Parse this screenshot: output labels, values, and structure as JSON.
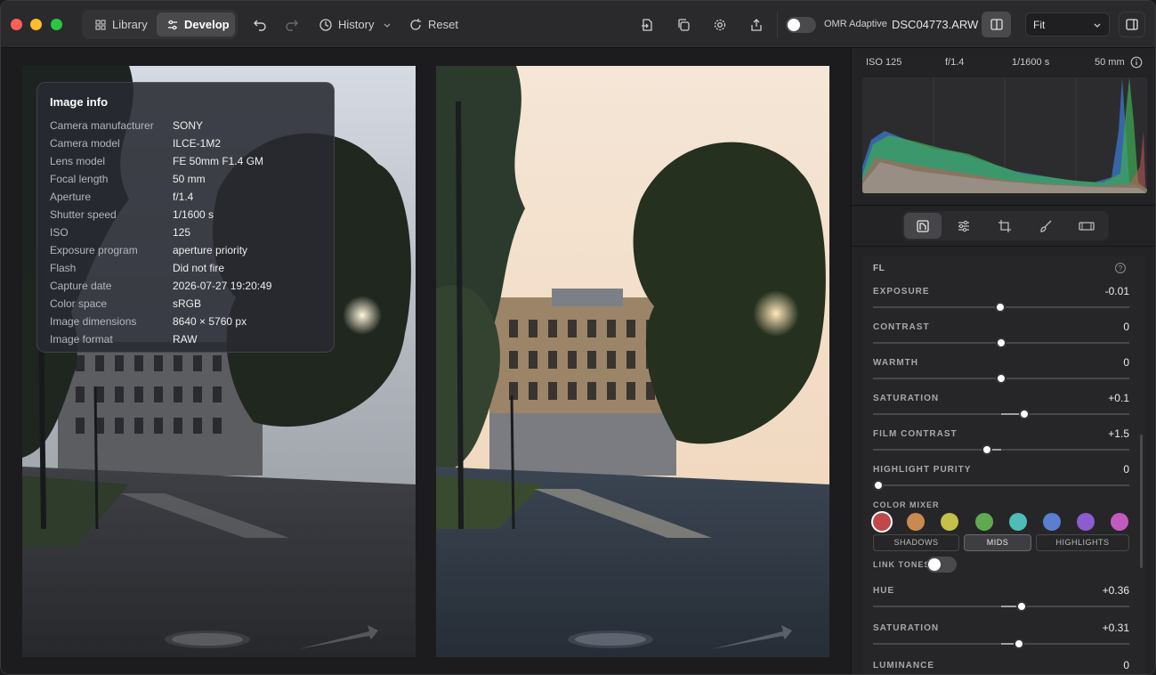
{
  "toolbar": {
    "library_label": "Library",
    "develop_label": "Develop",
    "history_label": "History",
    "reset_label": "Reset",
    "omr_label": "OMR Adaptive",
    "filename": "DSC04773.ARW",
    "zoom_value": "Fit"
  },
  "info": {
    "title": "Image info",
    "rows": [
      {
        "key": "Camera manufacturer",
        "value": "SONY"
      },
      {
        "key": "Camera model",
        "value": "ILCE-1M2"
      },
      {
        "key": "Lens model",
        "value": "FE 50mm F1.4 GM"
      },
      {
        "key": "Focal length",
        "value": "50 mm"
      },
      {
        "key": "Aperture",
        "value": "f/1.4"
      },
      {
        "key": "Shutter speed",
        "value": "1/1600 s"
      },
      {
        "key": "ISO",
        "value": "125"
      },
      {
        "key": "Exposure program",
        "value": "aperture priority"
      },
      {
        "key": "Flash",
        "value": "Did not fire"
      },
      {
        "key": "Capture date",
        "value": "2026-07-27 19:20:49"
      },
      {
        "key": "Color space",
        "value": "sRGB"
      },
      {
        "key": "Image dimensions",
        "value": "8640 × 5760 px"
      },
      {
        "key": "Image format",
        "value": "RAW"
      }
    ]
  },
  "exif": {
    "iso": "ISO 125",
    "aperture": "f/1.4",
    "shutter": "1/1600 s",
    "focal": "50 mm"
  },
  "adjustments": {
    "section_title": "FL",
    "help": "?",
    "sliders": [
      {
        "label": "EXPOSURE",
        "value": "-0.01",
        "position": 0.497
      },
      {
        "label": "CONTRAST",
        "value": "0",
        "position": 0.5
      },
      {
        "label": "WARMTH",
        "value": "0",
        "position": 0.5
      },
      {
        "label": "SATURATION",
        "value": "+0.1",
        "position": 0.59
      },
      {
        "label": "FILM CONTRAST",
        "value": "+1.5",
        "position": 0.445
      },
      {
        "label": "HIGHLIGHT PURITY",
        "value": "0",
        "position": 0.02
      }
    ],
    "color_mixer_label": "COLOR MIXER",
    "swatches": [
      "#c0474a",
      "#c98a50",
      "#c4c04a",
      "#5faa4f",
      "#4fbdb7",
      "#5a7fd0",
      "#8e5bd0",
      "#c35ac0"
    ],
    "tones": [
      "SHADOWS",
      "MIDS",
      "HIGHLIGHTS"
    ],
    "active_tone": "MIDS",
    "link_tones_label": "LINK TONES",
    "mixer_sliders": [
      {
        "label": "HUE",
        "value": "+0.36",
        "position": 0.58
      },
      {
        "label": "SATURATION",
        "value": "+0.31",
        "position": 0.57
      },
      {
        "label": "LUMINANCE",
        "value": "0",
        "position": 0.5
      }
    ]
  }
}
